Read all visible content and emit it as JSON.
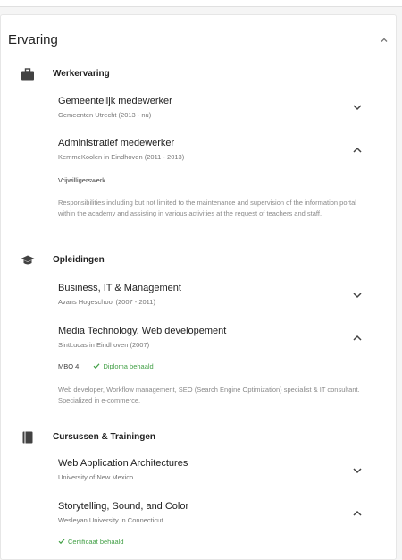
{
  "card": {
    "title": "Ervaring"
  },
  "sections": {
    "work": {
      "title": "Werkervaring",
      "icon": "briefcase-icon",
      "entries": [
        {
          "title": "Gemeentelijk medewerker",
          "subtitle": "Gemeenten Utrecht (2013 - nu)"
        },
        {
          "title": "Administratief medewerker",
          "subtitle": "KemmeKoolen in Eindhoven (2011 - 2013)",
          "type": "Vrijwilligerswerk",
          "description": "Responsibilities including but not limited to the maintenance and supervision of the information portal within the academy and assisting in various activities at the request of teachers and staff."
        }
      ]
    },
    "education": {
      "title": "Opleidingen",
      "icon": "graduation-cap-icon",
      "entries": [
        {
          "title": "Business, IT & Management",
          "subtitle": "Avans Hogeschool (2007 - 2011)"
        },
        {
          "title": "Media Technology, Web developement",
          "subtitle": "SintLucas in Eindhoven (2007)",
          "level": "MBO 4",
          "status": "Diploma behaald",
          "description": "Web developer, Workflow management, SEO (Search Engine Optimization) specialist & IT consultant. Specialized in e-commerce."
        }
      ]
    },
    "courses": {
      "title": "Cursussen & Trainingen",
      "icon": "book-icon",
      "entries": [
        {
          "title": "Web Application Architectures",
          "subtitle": "University of New Mexico"
        },
        {
          "title": "Storytelling, Sound, and Color",
          "subtitle": "Wesleyan University in Connecticut",
          "status": "Certificaat behaald"
        }
      ]
    }
  },
  "colors": {
    "success": "#43a047",
    "muted": "#8a8a8a",
    "icon": "#424242"
  }
}
